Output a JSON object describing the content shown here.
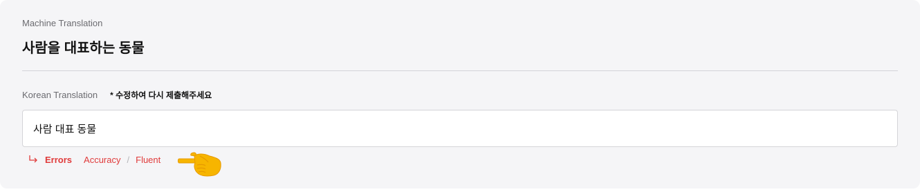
{
  "machine_translation": {
    "label": "Machine Translation",
    "text": "사람을 대표하는 동물"
  },
  "korean_translation": {
    "label": "Korean Translation",
    "note": "* 수정하여 다시 제출해주세요",
    "value": "사람 대표 동물"
  },
  "errors": {
    "title": "Errors",
    "items": [
      "Accuracy",
      "Fluent"
    ],
    "separator": "/"
  },
  "icons": {
    "arrow": "return-arrow-icon",
    "pointer": "pointing-hand-icon"
  },
  "colors": {
    "error": "#e03a3a",
    "card_bg": "#f5f5f7",
    "hand": "#f7b500"
  }
}
